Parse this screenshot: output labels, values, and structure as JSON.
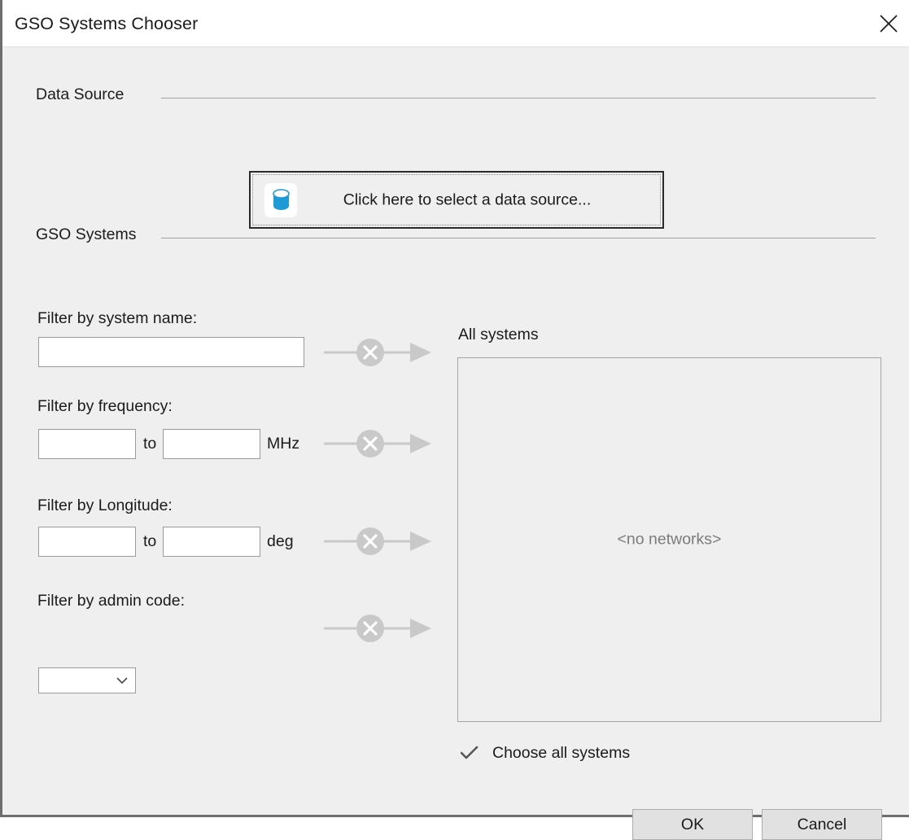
{
  "window": {
    "title": "GSO Systems Chooser",
    "close_icon": "close-icon",
    "background_color": "#efefef",
    "border_color": "#6e6e6e"
  },
  "sections": {
    "data_source": {
      "header": "Data Source",
      "button": {
        "label": "Click here to select a data source...",
        "icon": "database-icon",
        "icon_color": "#1e9ad6",
        "focused": true
      }
    },
    "gso_systems": {
      "header": "GSO Systems"
    }
  },
  "filters": [
    {
      "label": "Filter by system name:",
      "type": "text",
      "value": "",
      "placeholder": "",
      "unit": "",
      "apply_icon": "apply-filter-arrow-icon",
      "apply_enabled": false
    },
    {
      "label": "Filter by frequency:",
      "type": "range",
      "from_value": "",
      "to_label": "to",
      "to_value": "",
      "unit": "MHz",
      "apply_icon": "apply-filter-arrow-icon",
      "apply_enabled": false
    },
    {
      "label": "Filter by Longitude:",
      "type": "range",
      "from_value": "",
      "to_label": "to",
      "to_value": "",
      "unit": "deg",
      "apply_icon": "apply-filter-arrow-icon",
      "apply_enabled": false
    },
    {
      "label": "Filter by admin code:",
      "type": "combo",
      "value": "",
      "options": [],
      "chevron_icon": "chevron-down-icon",
      "apply_icon": "apply-filter-arrow-icon",
      "apply_enabled": false
    }
  ],
  "systems_panel": {
    "label": "All systems",
    "empty_text": "<no networks>",
    "items": []
  },
  "choose_all": {
    "label": "Choose all systems",
    "icon": "checkmark-icon",
    "checked": true
  },
  "footer": {
    "ok_label": "OK",
    "cancel_label": "Cancel"
  },
  "colors": {
    "accent": "#1e9ad6",
    "disabled_gray": "#c9c9c9",
    "muted_text": "#7c7c7c"
  }
}
